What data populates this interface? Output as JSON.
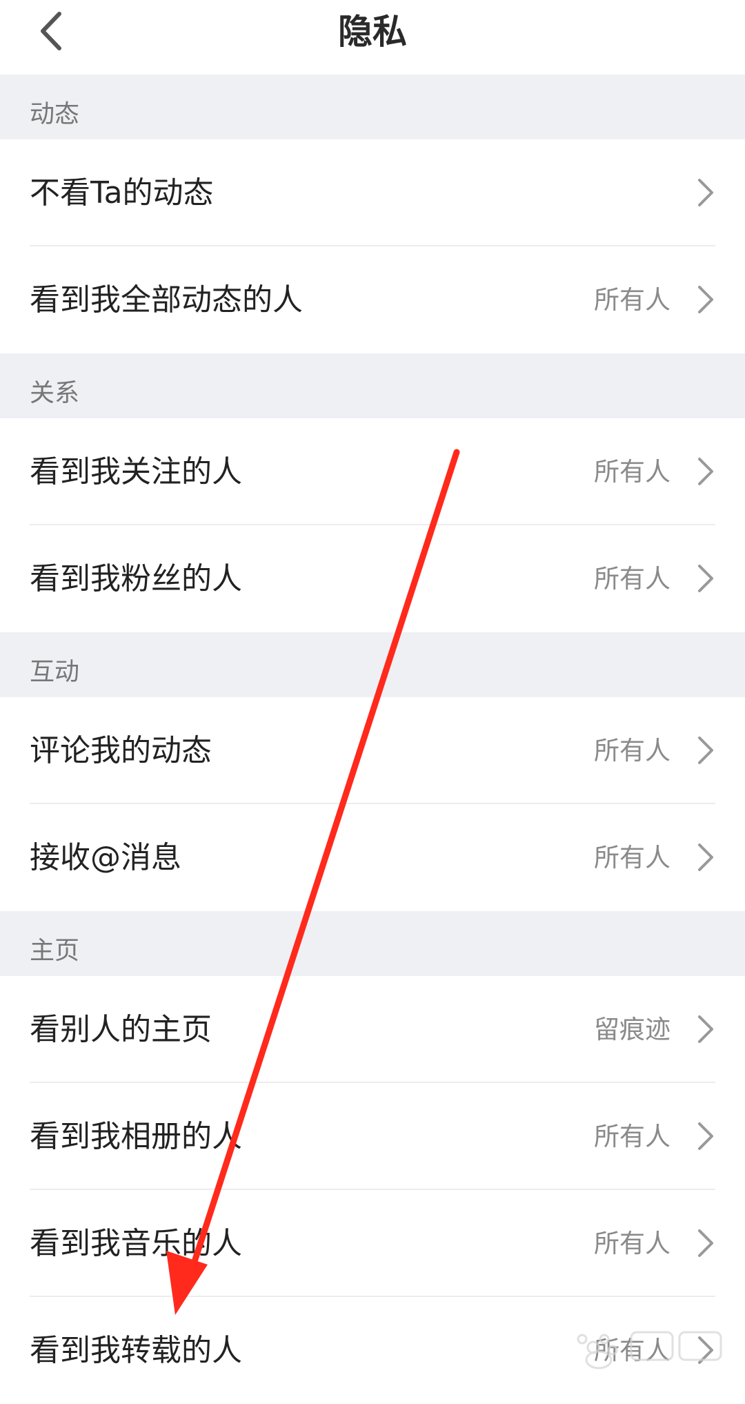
{
  "header": {
    "title": "隐私",
    "back_icon": "chevron-left-icon"
  },
  "sections": [
    {
      "label": "动态",
      "items": [
        {
          "label": "不看Ta的动态",
          "value": ""
        },
        {
          "label": "看到我全部动态的人",
          "value": "所有人"
        }
      ]
    },
    {
      "label": "关系",
      "items": [
        {
          "label": "看到我关注的人",
          "value": "所有人"
        },
        {
          "label": "看到我粉丝的人",
          "value": "所有人"
        }
      ]
    },
    {
      "label": "互动",
      "items": [
        {
          "label": "评论我的动态",
          "value": "所有人"
        },
        {
          "label": "接收@消息",
          "value": "所有人"
        }
      ]
    },
    {
      "label": "主页",
      "items": [
        {
          "label": "看别人的主页",
          "value": "留痕迹"
        },
        {
          "label": "看到我相册的人",
          "value": "所有人"
        },
        {
          "label": "看到我音乐的人",
          "value": "所有人"
        },
        {
          "label": "看到我转载的人",
          "value": "所有人"
        }
      ]
    }
  ],
  "colors": {
    "section_bg": "#eff0f4",
    "annotation_arrow": "#ff2a1c"
  }
}
